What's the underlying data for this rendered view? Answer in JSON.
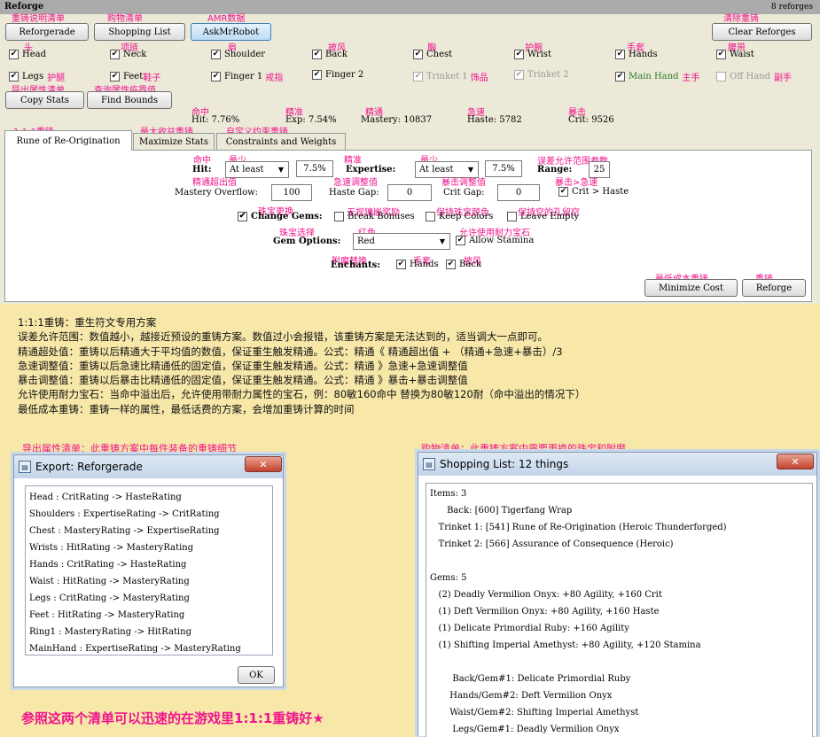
{
  "app": {
    "title": "Reforge",
    "count": "8 reforges"
  },
  "toolbar": {
    "reforgerade": "Reforgerade",
    "shopping": "Shopping List",
    "askmrrobot": "AskMrRobot",
    "clear": "Clear Reforges",
    "copy": "Copy Stats",
    "find": "Find Bounds"
  },
  "slots": {
    "head": {
      "label": "Head",
      "note": "头"
    },
    "neck": {
      "label": "Neck",
      "note": "项链"
    },
    "shoulder": {
      "label": "Shoulder",
      "note": "肩"
    },
    "back": {
      "label": "Back",
      "note": "披风"
    },
    "chest": {
      "label": "Chest",
      "note": "胸"
    },
    "wrist": {
      "label": "Wrist",
      "note": "护腕"
    },
    "hands": {
      "label": "Hands",
      "note": "手套"
    },
    "waist": {
      "label": "Waist",
      "note": "腰带"
    },
    "legs": {
      "label": "Legs",
      "note": "护腿"
    },
    "feet": {
      "label": "Feet",
      "note": "鞋子"
    },
    "finger1": {
      "label": "Finger 1",
      "note": "戒指"
    },
    "finger2": {
      "label": "Finger 2"
    },
    "trinket1": {
      "label": "Trinket 1",
      "note": "饰品"
    },
    "trinket2": {
      "label": "Trinket 2"
    },
    "mainhand": {
      "label": "Main Hand",
      "note": "主手"
    },
    "offhand": {
      "label": "Off Hand",
      "note": "副手"
    }
  },
  "stats": {
    "hit": "Hit: 7.76%",
    "exp": "Exp: 7.54%",
    "mastery": "Mastery: 10837",
    "haste": "Haste: 5782",
    "crit": "Crit: 9526",
    "hit_note": "命中",
    "exp_note": "精准",
    "mastery_note": "精通",
    "haste_note": "急速",
    "crit_note": "暴击"
  },
  "tabs": [
    {
      "label": "Rune of Re-Origination",
      "note": "1:1:1重铸"
    },
    {
      "label": "Maximize Stats",
      "note": "最大收益重铸"
    },
    {
      "label": "Constraints and Weights",
      "note": "自定义约束重铸"
    }
  ],
  "form": {
    "hit_label": "Hit:",
    "hit_mode": "At least",
    "hit_value": "7.5%",
    "hit_note_a": "命中",
    "hit_note_b": "最少",
    "exp_label": "Expertise:",
    "exp_mode": "At least",
    "exp_value": "7.5%",
    "exp_note_a": "精准",
    "exp_note_b": "最少",
    "range_label": "Range:",
    "range_value": "25",
    "range_note": "误差允许范围参数",
    "mastery_label": "Mastery Overflow:",
    "mastery_value": "100",
    "mastery_note": "精通超出值",
    "hastegap_label": "Haste Gap:",
    "hastegap_value": "0",
    "hastegap_note": "急速调整值",
    "critgap_label": "Crit Gap:",
    "critgap_value": "0",
    "critgap_note": "暴击调整值",
    "crit_haste": "Crit > Haste",
    "crit_haste_note": "暴击>急速",
    "change_gems": "Change Gems:",
    "change_gems_note": "珠宝更换",
    "break_bonuses": "Break Bonuses",
    "break_note": "无视镶嵌奖励",
    "keep_colors": "Keep Colors",
    "keep_note": "保持珠宝颜色",
    "leave_empty": "Leave Empty",
    "leave_note": "保持空的孔留空",
    "gem_options": "Gem Options:",
    "gem_options_note": "珠宝选择",
    "gem_color": "Red",
    "gem_color_note": "红色",
    "allow_stamina": "Allow Stamina",
    "allow_note": "允许使用耐力宝石",
    "enchants": "Enchants:",
    "enchants_note": "附魔替换",
    "ench_hands": "Hands",
    "ench_hands_note": "手套",
    "ench_back": "Back",
    "ench_back_note": "披风",
    "minimize": "Minimize Cost",
    "minimize_note": "最低成本重铸",
    "reforge": "Reforge",
    "reforge_note": "重铸"
  },
  "top_notes": {
    "reforgerade": "重铸说明清单",
    "shopping": "购物清单",
    "askmrrobot": "AMR数据",
    "clear": "清除重铸",
    "copy": "导出属性清单",
    "find": "查询属性临界值"
  },
  "notes": [
    "1:1:1重铸：重生符文专用方案",
    "误差允许范围：数值越小，越接近预设的重铸方案。数值过小会报错，该重铸方案是无法达到的，适当调大一点即可。",
    "精通超处值：重铸以后精通大于平均值的数值，保证重生触发精通。公式：精通《  精通超出值 + （精通+急速+暴击）/3",
    "急速调整值：重铸以后急速比精通低的固定值，保证重生触发精通。公式：精通 》急速+急速调整值",
    "暴击调整值：重铸以后暴击比精通低的固定值，保证重生触发精通。公式：精通 》暴击+暴击调整值",
    "允许使用耐力宝石：当命中溢出后，允许使用带耐力属性的宝石，例：80敏160命中 替换为80敏120耐（命中溢出的情况下）",
    "最低成本重铸：重铸一样的属性，最低话费的方案，会增加重铸计算的时间"
  ],
  "export_note": "导出属性清单：此重铸方案中每件装备的重铸细节",
  "shopping_note": "购物清单：此重铸方案中需要更换的珠宝和附魔",
  "bottom_note": "参照这两个清单可以迅速的在游戏里1:1:1重铸好★",
  "export_window": {
    "title": "Export: Reforgerade",
    "lines": [
      "Head : CritRating -> HasteRating",
      "Shoulders : ExpertiseRating -> CritRating",
      "Chest : MasteryRating -> ExpertiseRating",
      "Wrists : HitRating -> MasteryRating",
      "Hands : CritRating -> HasteRating",
      "Waist : HitRating -> MasteryRating",
      "Legs : CritRating -> MasteryRating",
      "Feet : HitRating -> MasteryRating",
      "Ring1 : MasteryRating -> HitRating",
      "MainHand : ExpertiseRating -> MasteryRating"
    ],
    "ok": "OK"
  },
  "shopping_window": {
    "title": "Shopping List: 12 things",
    "lines": [
      "Items: 3",
      "      Back: [600] Tigerfang Wrap",
      "   Trinket 1: [541] Rune of Re-Origination (Heroic Thunderforged)",
      "   Trinket 2: [566] Assurance of Consequence (Heroic)",
      "",
      "Gems: 5",
      "   (2) Deadly Vermilion Onyx: +80 Agility, +160 Crit",
      "   (1) Deft Vermilion Onyx: +80 Agility, +160 Haste",
      "   (1) Delicate Primordial Ruby: +160 Agility",
      "   (1) Shifting Imperial Amethyst: +80 Agility, +120 Stamina",
      "",
      "        Back/Gem#1: Delicate Primordial Ruby",
      "       Hands/Gem#2: Deft Vermilion Onyx",
      "       Waist/Gem#2: Shifting Imperial Amethyst",
      "        Legs/Gem#1: Deadly Vermilion Onyx"
    ]
  }
}
